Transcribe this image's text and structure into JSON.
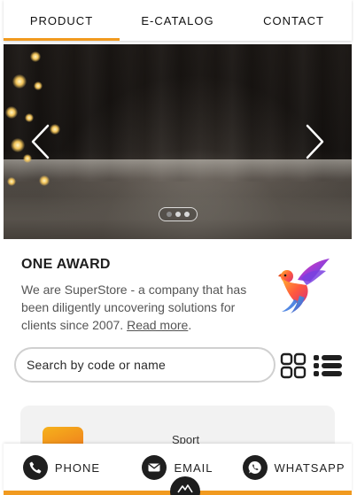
{
  "tabs": [
    {
      "label": "PRODUCT",
      "active": true
    },
    {
      "label": "E-CATALOG",
      "active": false
    },
    {
      "label": "CONTACT",
      "active": false
    }
  ],
  "slider": {
    "slide_count": 3,
    "active_index": 0,
    "prev_icon": "chevron-left-icon",
    "next_icon": "chevron-right-icon"
  },
  "about": {
    "title": "ONE AWARD",
    "text": "We are SuperStore - a company that has been diligently uncovering solutions for clients since 2007.",
    "read_more": "Read more",
    "trailing": ".",
    "logo_icon": "bird-logo-icon"
  },
  "search": {
    "placeholder": "Search by code or name",
    "value": ""
  },
  "view_toggle": {
    "grid_icon": "grid-view-icon",
    "list_icon": "list-view-icon"
  },
  "product_card": {
    "category": "Sport"
  },
  "contact_bar": {
    "phone_label": "PHONE",
    "email_label": "EMAIL",
    "whatsapp_label": "WHATSAPP"
  },
  "colors": {
    "accent": "#f19a1f",
    "dark": "#1f1f1f"
  }
}
